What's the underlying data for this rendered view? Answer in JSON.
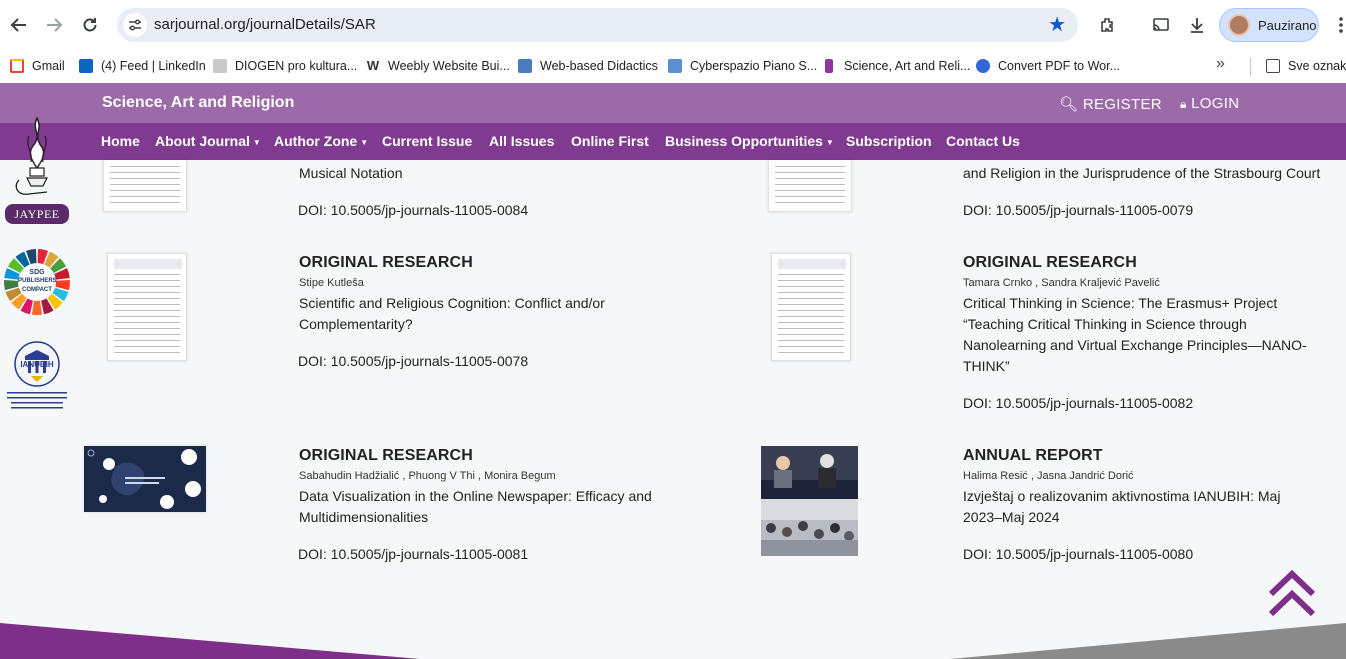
{
  "browser": {
    "url": "sarjournal.org/journalDetails/SAR",
    "profile_name": "Pauzirano",
    "bookmarks": [
      {
        "label": "Gmail",
        "color": "#ea4335"
      },
      {
        "label": "(4) Feed | LinkedIn",
        "color": "#0a66c2"
      },
      {
        "label": "DIOGEN pro kultura...",
        "color": "#8d8d8d"
      },
      {
        "label": "Weebly Website Bui...",
        "color": "#333333"
      },
      {
        "label": "Web-based Didactics",
        "color": "#4a7bbf"
      },
      {
        "label": "Cyberspazio Piano S...",
        "color": "#5a8fd0"
      },
      {
        "label": "Science, Art and Reli...",
        "color": "#8e3a9a"
      },
      {
        "label": "Convert PDF to Wor...",
        "color": "#3367d6"
      },
      {
        "label": "Sve oznake",
        "color": "#444444"
      }
    ]
  },
  "site": {
    "title": "Science, Art and Religion",
    "register": "REGISTER",
    "login": "LOGIN",
    "nav": [
      {
        "label": "Home",
        "dropdown": false
      },
      {
        "label": "About Journal",
        "dropdown": true
      },
      {
        "label": "Author Zone",
        "dropdown": true
      },
      {
        "label": "Current Issue",
        "dropdown": false
      },
      {
        "label": "All Issues",
        "dropdown": false
      },
      {
        "label": "Online First",
        "dropdown": false
      },
      {
        "label": "Business Opportunities",
        "dropdown": true
      },
      {
        "label": "Subscription",
        "dropdown": false
      },
      {
        "label": "Contact Us",
        "dropdown": false
      }
    ],
    "colors": {
      "header": "#9c6aa8",
      "nav": "#803a8f",
      "accent": "#7e2f8a"
    }
  },
  "sidebar": {
    "jaypee_label": "JAYPEE",
    "sdg_label_1": "SDG",
    "sdg_label_2": "PUBLISHERS",
    "sdg_label_3": "COMPACT",
    "ianubih_label": "IANUBIH"
  },
  "articles": [
    {
      "type": "",
      "authors": "",
      "title": "Musical Notation",
      "doi": "DOI: 10.5005/jp-journals-11005-0084"
    },
    {
      "type": "",
      "authors": "",
      "title": "and Religion in the Jurisprudence of the Strasbourg Court",
      "doi": "DOI: 10.5005/jp-journals-11005-0079"
    },
    {
      "type": "ORIGINAL RESEARCH",
      "authors": "Stipe Kutleša",
      "title": "Scientific and Religious Cognition: Conflict and/or Complementarity?",
      "doi": "DOI: 10.5005/jp-journals-11005-0078"
    },
    {
      "type": "ORIGINAL RESEARCH",
      "authors": "Tamara Crnko , Sandra Kraljević Pavelić",
      "title": "Critical Thinking in Science: The Erasmus+ Project “Teaching Critical Thinking in Science through Nanolearning and Virtual Exchange Principles—NANO-THINK”",
      "doi": "DOI: 10.5005/jp-journals-11005-0082"
    },
    {
      "type": "ORIGINAL RESEARCH",
      "authors": "Sabahudin Hadžialić , Phuong V Thi , Monira Begum",
      "title": "Data Visualization in the Online Newspaper: Efficacy and Multidimensionalities",
      "doi": "DOI: 10.5005/jp-journals-11005-0081"
    },
    {
      "type": "ANNUAL REPORT",
      "authors": "Halima Resić , Jasna Jandrić Dorić",
      "title": "Izvještaj o realizovanim aktivnostima IANUBIH: Maj 2023–Maj 2024",
      "doi": "DOI: 10.5005/jp-journals-11005-0080"
    }
  ]
}
